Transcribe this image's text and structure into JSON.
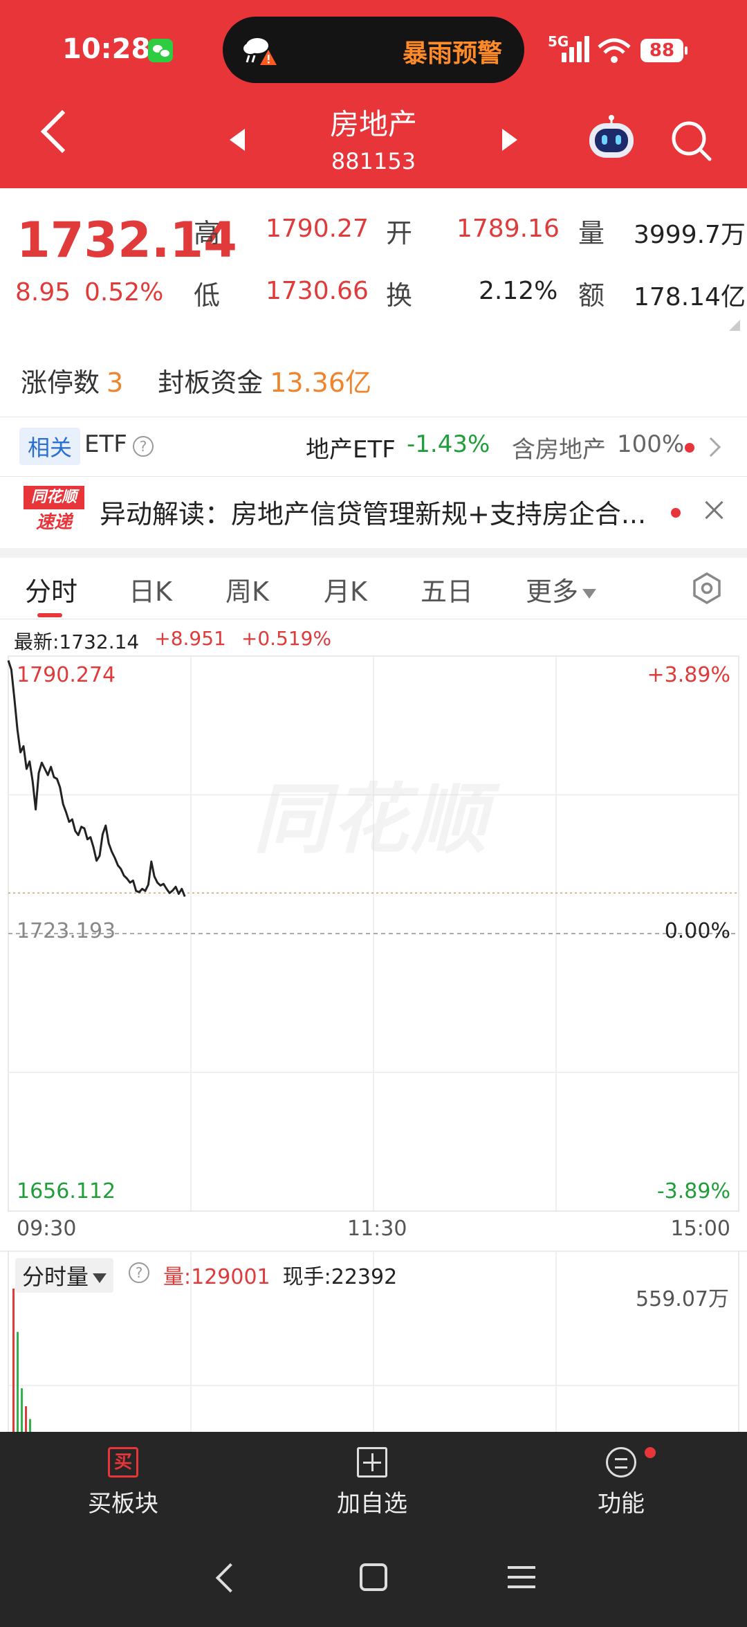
{
  "status_bar": {
    "time": "10:28",
    "island_text": "暴雨预警",
    "signal_label": "5G",
    "battery": "88"
  },
  "header": {
    "title": "房地产",
    "code": "881153"
  },
  "quote": {
    "price": "1732.14",
    "change_abs": "8.95",
    "change_pct": "0.52%",
    "high_label": "高",
    "high_value": "1790.27",
    "low_label": "低",
    "low_value": "1730.66",
    "open_label": "开",
    "open_value": "1789.16",
    "turnover_label": "换",
    "turnover_value": "2.12%",
    "volume_label": "量",
    "volume_value": "3999.7万",
    "amount_label": "额",
    "amount_value": "178.14亿"
  },
  "limit_up": {
    "count_label": "涨停数",
    "count_value": "3",
    "fund_label": "封板资金",
    "fund_value": "13.36亿"
  },
  "etf": {
    "tag": "相关",
    "label": "ETF",
    "name": "地产ETF",
    "change": "-1.43%",
    "contains_label": "含房地产",
    "contains_value": "100%"
  },
  "news": {
    "logo_line1": "同花顺",
    "logo_line2": "速递",
    "text": "异动解读：房地产信贷管理新规+支持房企合..."
  },
  "tabs": [
    {
      "label": "分时",
      "active": true
    },
    {
      "label": "日K"
    },
    {
      "label": "周K"
    },
    {
      "label": "月K"
    },
    {
      "label": "五日"
    },
    {
      "label": "更多"
    }
  ],
  "chart_info": {
    "latest": "最新:1732.14",
    "change": "+8.951",
    "change_pct": "+0.519%"
  },
  "chart_labels": {
    "top_price": "1790.274",
    "top_pct": "+3.89%",
    "mid_price": "1723.193",
    "mid_pct": "0.00%",
    "bottom_price": "1656.112",
    "bottom_pct": "-3.89%",
    "watermark": "同花顺",
    "time_start": "09:30",
    "time_mid": "11:30",
    "time_end": "15:00"
  },
  "volume_panel": {
    "selector": "分时量",
    "volume": "量:129001",
    "current_hand": "现手:22392",
    "max": "559.07万"
  },
  "bottom_bar": {
    "buy_icon_char": "买",
    "buy_label": "买板块",
    "add_label": "加自选",
    "func_label": "功能"
  },
  "chart_data": {
    "type": "line",
    "title": "",
    "xlabel": "",
    "ylabel": "",
    "x": [
      "09:30",
      "09:31",
      "09:32",
      "09:33",
      "09:34",
      "09:35",
      "09:36",
      "09:37",
      "09:38",
      "09:39",
      "09:40",
      "09:41",
      "09:42",
      "09:43",
      "09:44",
      "09:45",
      "09:46",
      "09:47",
      "09:48",
      "09:49",
      "09:50",
      "09:51",
      "09:52",
      "09:53",
      "09:54",
      "09:55",
      "09:56",
      "09:57",
      "09:58",
      "09:59",
      "10:00",
      "10:01",
      "10:02",
      "10:03",
      "10:04",
      "10:05",
      "10:06",
      "10:07",
      "10:08",
      "10:09",
      "10:10",
      "10:11",
      "10:12",
      "10:13",
      "10:14",
      "10:15",
      "10:16",
      "10:17",
      "10:18",
      "10:19",
      "10:20",
      "10:21",
      "10:22",
      "10:23",
      "10:24",
      "10:25",
      "10:26",
      "10:27",
      "10:28"
    ],
    "series": [
      {
        "values": [
          1789.2,
          1787.0,
          1780.0,
          1772.5,
          1767.0,
          1768.5,
          1763.0,
          1764.8,
          1760.0,
          1753.2,
          1762.0,
          1764.5,
          1763.0,
          1761.5,
          1763.5,
          1761.0,
          1760.6,
          1758.5,
          1754.5,
          1752.5,
          1750.2,
          1750.8,
          1748.0,
          1747.0,
          1749.0,
          1748.6,
          1746.0,
          1746.5,
          1744.0,
          1740.8,
          1742.0,
          1747.2,
          1749.3,
          1745.0,
          1743.0,
          1741.5,
          1739.7,
          1738.8,
          1737.2,
          1736.5,
          1735.5,
          1736.0,
          1733.5,
          1733.2,
          1734.0,
          1733.5,
          1735.0,
          1740.6,
          1737.0,
          1735.5,
          1734.8,
          1735.2,
          1734.0,
          1733.0,
          1733.6,
          1734.5,
          1732.8,
          1734.0,
          1732.14
        ]
      }
    ],
    "ylim": [
      1656.112,
      1790.274
    ],
    "baseline": 1723.193,
    "pct_labels": [
      "+3.89%",
      "0.00%",
      "-3.89%"
    ],
    "average_line": 1733.0,
    "volume": {
      "max_label": "559.07万",
      "max_value": 5590700,
      "values": [
        5590700,
        3900000,
        1700000,
        1000000,
        500000
      ]
    },
    "grid": true,
    "colors": {
      "price_line": "#222222",
      "baseline": "#aaaaaa",
      "up": "#e03a3a",
      "down": "#1f9e3a",
      "volume": "#2fb44a"
    }
  }
}
